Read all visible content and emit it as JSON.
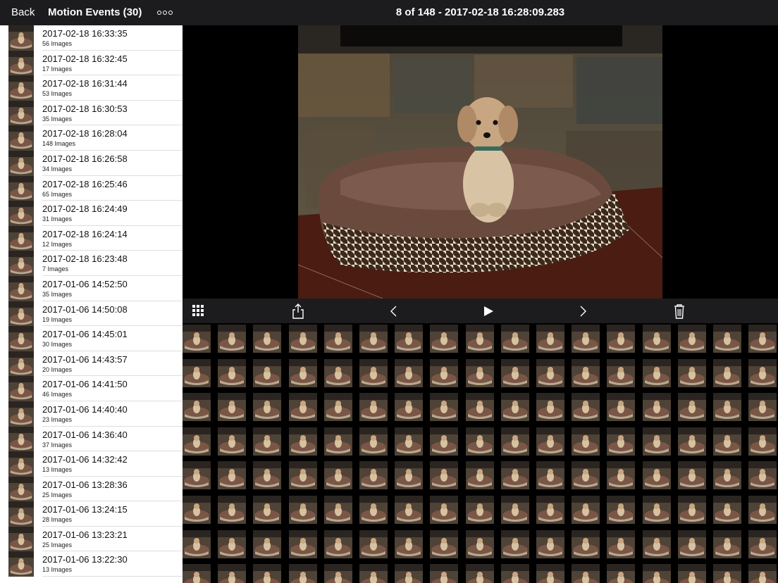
{
  "header": {
    "back_label": "Back",
    "events_title": "Motion Events (30)",
    "frame_info": "8 of 148 - 2017-02-18 16:28:09.283"
  },
  "icons": {
    "more": "more-options-icon",
    "grid": "grid-view-icon",
    "share": "share-icon",
    "prev": "chevron-left-icon",
    "play": "play-icon",
    "next": "chevron-right-icon",
    "trash": "trash-icon"
  },
  "events": [
    {
      "time": "2017-02-18 16:33:35",
      "count": "56 Images"
    },
    {
      "time": "2017-02-18 16:32:45",
      "count": "17 Images"
    },
    {
      "time": "2017-02-18 16:31:44",
      "count": "53 Images"
    },
    {
      "time": "2017-02-18 16:30:53",
      "count": "35 Images"
    },
    {
      "time": "2017-02-18 16:28:04",
      "count": "148 Images"
    },
    {
      "time": "2017-02-18 16:26:58",
      "count": "34 Images"
    },
    {
      "time": "2017-02-18 16:25:46",
      "count": "65 Images"
    },
    {
      "time": "2017-02-18 16:24:49",
      "count": "31 Images"
    },
    {
      "time": "2017-02-18 16:24:14",
      "count": "12 Images"
    },
    {
      "time": "2017-02-18 16:23:48",
      "count": "7 Images"
    },
    {
      "time": "2017-01-06 14:52:50",
      "count": "35 Images"
    },
    {
      "time": "2017-01-06 14:50:08",
      "count": "19 Images"
    },
    {
      "time": "2017-01-06 14:45:01",
      "count": "30 Images"
    },
    {
      "time": "2017-01-06 14:43:57",
      "count": "20 Images"
    },
    {
      "time": "2017-01-06 14:41:50",
      "count": "46 Images"
    },
    {
      "time": "2017-01-06 14:40:40",
      "count": "23 Images"
    },
    {
      "time": "2017-01-06 14:36:40",
      "count": "37 Images"
    },
    {
      "time": "2017-01-06 14:32:42",
      "count": "13 Images"
    },
    {
      "time": "2017-01-06 13:28:36",
      "count": "25 Images"
    },
    {
      "time": "2017-01-06 13:24:15",
      "count": "28 Images"
    },
    {
      "time": "2017-01-06 13:23:21",
      "count": "25 Images"
    },
    {
      "time": "2017-01-06 13:22:30",
      "count": "13 Images"
    }
  ],
  "colors": {
    "bar_bg": "#1c1c1e",
    "sidebar_bg": "#ffffff",
    "divider": "#dedede"
  }
}
